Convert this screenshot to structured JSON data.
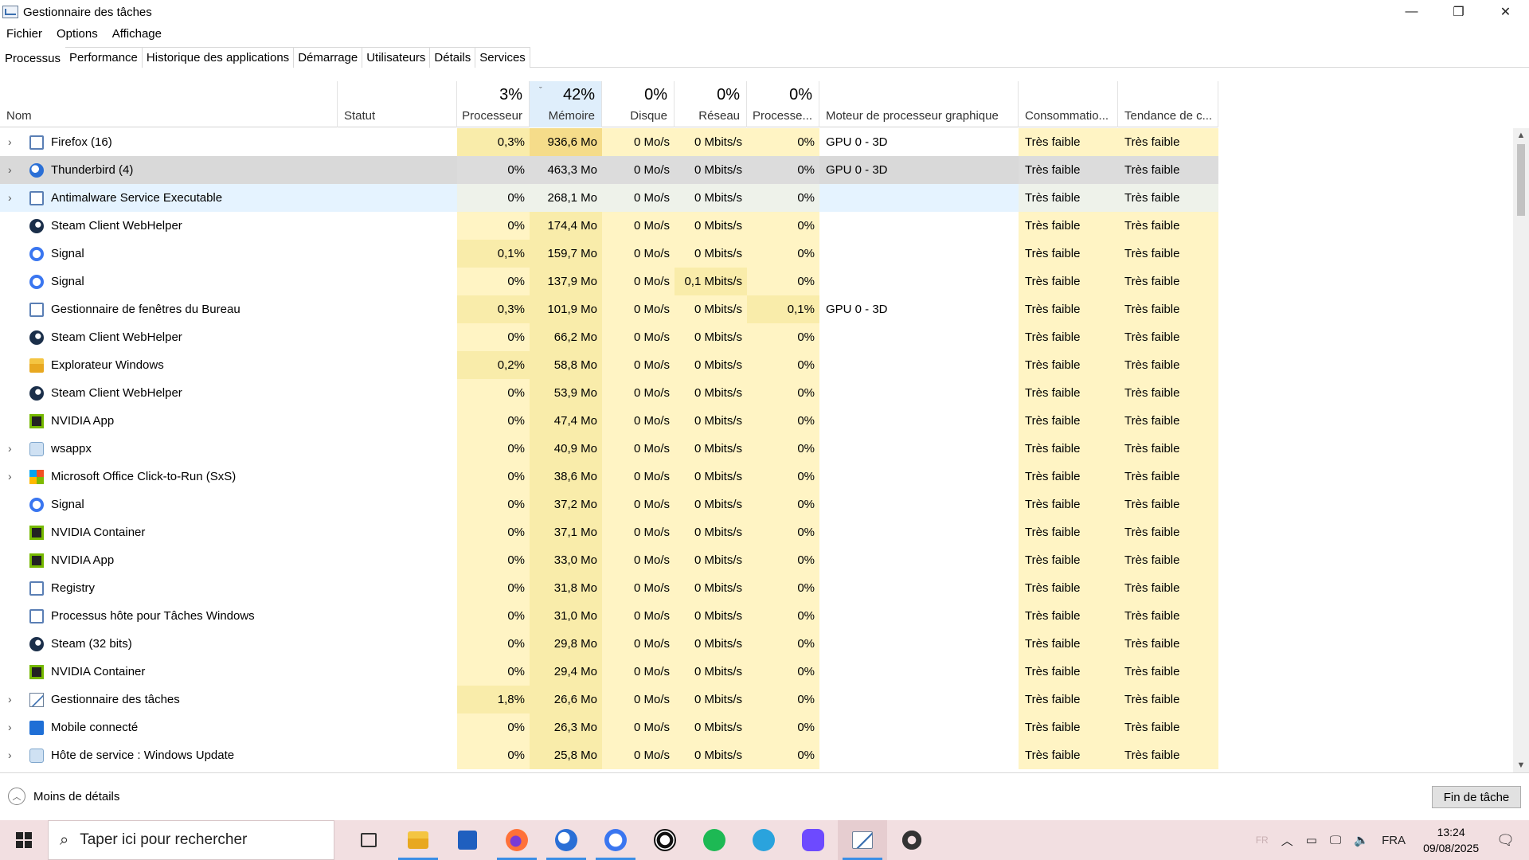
{
  "window": {
    "title": "Gestionnaire des tâches",
    "controls": {
      "minimize": "—",
      "maximize": "❐",
      "close": "✕"
    }
  },
  "menu": [
    "Fichier",
    "Options",
    "Affichage"
  ],
  "tabs": [
    "Processus",
    "Performance",
    "Historique des applications",
    "Démarrage",
    "Utilisateurs",
    "Détails",
    "Services"
  ],
  "columns": {
    "name": {
      "label": "Nom"
    },
    "status": {
      "label": "Statut"
    },
    "cpu": {
      "pct": "3%",
      "label": "Processeur"
    },
    "mem": {
      "pct": "42%",
      "label": "Mémoire",
      "sort": "ˇ"
    },
    "disk": {
      "pct": "0%",
      "label": "Disque"
    },
    "net": {
      "pct": "0%",
      "label": "Réseau"
    },
    "gpu": {
      "pct": "0%",
      "label": "Processe..."
    },
    "gpu_engine": {
      "label": "Moteur de processeur graphique"
    },
    "power": {
      "label": "Consommatio..."
    },
    "power_trend": {
      "label": "Tendance de c..."
    }
  },
  "processes": [
    {
      "name": "Firefox (16)",
      "expand": true,
      "icon": "generic-app-icon",
      "cpu": "0,3%",
      "mem": "936,6 Mo",
      "disk": "0 Mo/s",
      "net": "0 Mbits/s",
      "gpu": "0%",
      "engine": "GPU 0 - 3D",
      "power": "Très faible",
      "trend": "Très faible"
    },
    {
      "name": "Thunderbird (4)",
      "expand": true,
      "icon": "thunderbird-icon",
      "cpu": "0%",
      "mem": "463,3 Mo",
      "disk": "0 Mo/s",
      "net": "0 Mbits/s",
      "gpu": "0%",
      "engine": "GPU 0 - 3D",
      "power": "Très faible",
      "trend": "Très faible"
    },
    {
      "name": "Antimalware Service Executable",
      "expand": true,
      "icon": "generic-app-icon",
      "cpu": "0%",
      "mem": "268,1 Mo",
      "disk": "0 Mo/s",
      "net": "0 Mbits/s",
      "gpu": "0%",
      "engine": "",
      "power": "Très faible",
      "trend": "Très faible"
    },
    {
      "name": "Steam Client WebHelper",
      "expand": false,
      "icon": "steam-icon",
      "cpu": "0%",
      "mem": "174,4 Mo",
      "disk": "0 Mo/s",
      "net": "0 Mbits/s",
      "gpu": "0%",
      "engine": "",
      "power": "Très faible",
      "trend": "Très faible"
    },
    {
      "name": "Signal",
      "expand": false,
      "icon": "signal-icon",
      "cpu": "0,1%",
      "mem": "159,7 Mo",
      "disk": "0 Mo/s",
      "net": "0 Mbits/s",
      "gpu": "0%",
      "engine": "",
      "power": "Très faible",
      "trend": "Très faible"
    },
    {
      "name": "Signal",
      "expand": false,
      "icon": "signal-icon",
      "cpu": "0%",
      "mem": "137,9 Mo",
      "disk": "0 Mo/s",
      "net": "0,1 Mbits/s",
      "gpu": "0%",
      "engine": "",
      "power": "Très faible",
      "trend": "Très faible"
    },
    {
      "name": "Gestionnaire de fenêtres du Bureau",
      "expand": false,
      "icon": "generic-app-icon",
      "cpu": "0,3%",
      "mem": "101,9 Mo",
      "disk": "0 Mo/s",
      "net": "0 Mbits/s",
      "gpu": "0,1%",
      "engine": "GPU 0 - 3D",
      "power": "Très faible",
      "trend": "Très faible"
    },
    {
      "name": "Steam Client WebHelper",
      "expand": false,
      "icon": "steam-icon",
      "cpu": "0%",
      "mem": "66,2 Mo",
      "disk": "0 Mo/s",
      "net": "0 Mbits/s",
      "gpu": "0%",
      "engine": "",
      "power": "Très faible",
      "trend": "Très faible"
    },
    {
      "name": "Explorateur Windows",
      "expand": false,
      "icon": "folder-icon",
      "cpu": "0,2%",
      "mem": "58,8 Mo",
      "disk": "0 Mo/s",
      "net": "0 Mbits/s",
      "gpu": "0%",
      "engine": "",
      "power": "Très faible",
      "trend": "Très faible"
    },
    {
      "name": "Steam Client WebHelper",
      "expand": false,
      "icon": "steam-icon",
      "cpu": "0%",
      "mem": "53,9 Mo",
      "disk": "0 Mo/s",
      "net": "0 Mbits/s",
      "gpu": "0%",
      "engine": "",
      "power": "Très faible",
      "trend": "Très faible"
    },
    {
      "name": "NVIDIA App",
      "expand": false,
      "icon": "nvidia-icon",
      "cpu": "0%",
      "mem": "47,4 Mo",
      "disk": "0 Mo/s",
      "net": "0 Mbits/s",
      "gpu": "0%",
      "engine": "",
      "power": "Très faible",
      "trend": "Très faible"
    },
    {
      "name": "wsappx",
      "expand": true,
      "icon": "gear-app-icon",
      "cpu": "0%",
      "mem": "40,9 Mo",
      "disk": "0 Mo/s",
      "net": "0 Mbits/s",
      "gpu": "0%",
      "engine": "",
      "power": "Très faible",
      "trend": "Très faible"
    },
    {
      "name": "Microsoft Office Click-to-Run (SxS)",
      "expand": true,
      "icon": "office-icon",
      "cpu": "0%",
      "mem": "38,6 Mo",
      "disk": "0 Mo/s",
      "net": "0 Mbits/s",
      "gpu": "0%",
      "engine": "",
      "power": "Très faible",
      "trend": "Très faible"
    },
    {
      "name": "Signal",
      "expand": false,
      "icon": "signal-icon",
      "cpu": "0%",
      "mem": "37,2 Mo",
      "disk": "0 Mo/s",
      "net": "0 Mbits/s",
      "gpu": "0%",
      "engine": "",
      "power": "Très faible",
      "trend": "Très faible"
    },
    {
      "name": "NVIDIA Container",
      "expand": false,
      "icon": "nvidia-icon",
      "cpu": "0%",
      "mem": "37,1 Mo",
      "disk": "0 Mo/s",
      "net": "0 Mbits/s",
      "gpu": "0%",
      "engine": "",
      "power": "Très faible",
      "trend": "Très faible"
    },
    {
      "name": "NVIDIA App",
      "expand": false,
      "icon": "nvidia-icon",
      "cpu": "0%",
      "mem": "33,0 Mo",
      "disk": "0 Mo/s",
      "net": "0 Mbits/s",
      "gpu": "0%",
      "engine": "",
      "power": "Très faible",
      "trend": "Très faible"
    },
    {
      "name": "Registry",
      "expand": false,
      "icon": "generic-app-icon",
      "cpu": "0%",
      "mem": "31,8 Mo",
      "disk": "0 Mo/s",
      "net": "0 Mbits/s",
      "gpu": "0%",
      "engine": "",
      "power": "Très faible",
      "trend": "Très faible"
    },
    {
      "name": "Processus hôte pour Tâches Windows",
      "expand": false,
      "icon": "generic-app-icon",
      "cpu": "0%",
      "mem": "31,0 Mo",
      "disk": "0 Mo/s",
      "net": "0 Mbits/s",
      "gpu": "0%",
      "engine": "",
      "power": "Très faible",
      "trend": "Très faible"
    },
    {
      "name": "Steam (32 bits)",
      "expand": false,
      "icon": "steam-icon",
      "cpu": "0%",
      "mem": "29,8 Mo",
      "disk": "0 Mo/s",
      "net": "0 Mbits/s",
      "gpu": "0%",
      "engine": "",
      "power": "Très faible",
      "trend": "Très faible"
    },
    {
      "name": "NVIDIA Container",
      "expand": false,
      "icon": "nvidia-icon",
      "cpu": "0%",
      "mem": "29,4 Mo",
      "disk": "0 Mo/s",
      "net": "0 Mbits/s",
      "gpu": "0%",
      "engine": "",
      "power": "Très faible",
      "trend": "Très faible"
    },
    {
      "name": "Gestionnaire des tâches",
      "expand": true,
      "icon": "taskmanager-icon",
      "cpu": "1,8%",
      "mem": "26,6 Mo",
      "disk": "0 Mo/s",
      "net": "0 Mbits/s",
      "gpu": "0%",
      "engine": "",
      "power": "Très faible",
      "trend": "Très faible"
    },
    {
      "name": "Mobile connecté",
      "expand": true,
      "icon": "phone-link-icon",
      "cpu": "0%",
      "mem": "26,3 Mo",
      "disk": "0 Mo/s",
      "net": "0 Mbits/s",
      "gpu": "0%",
      "engine": "",
      "power": "Très faible",
      "trend": "Très faible"
    },
    {
      "name": "Hôte de service : Windows Update",
      "expand": true,
      "icon": "gear-app-icon",
      "cpu": "0%",
      "mem": "25,8 Mo",
      "disk": "0 Mo/s",
      "net": "0 Mbits/s",
      "gpu": "0%",
      "engine": "",
      "power": "Très faible",
      "trend": "Très faible"
    }
  ],
  "footer": {
    "less_details": "Moins de détails",
    "end_task": "Fin de tâche"
  },
  "taskbar": {
    "search_placeholder": "Taper ici pour rechercher",
    "apps": [
      "task-view-icon",
      "file-explorer-icon",
      "store-icon",
      "firefox-icon",
      "thunderbird-icon",
      "signal-icon",
      "whatsapp-icon",
      "spotify-icon",
      "telegram-icon",
      "proton-vpn-icon",
      "taskmanager-icon",
      "settings-icon"
    ],
    "tray": {
      "lang_hint": "FR",
      "lang": "FRA",
      "time": "13:24",
      "date": "09/08/2025"
    }
  },
  "colors": {
    "heat_low": "#fff4c4",
    "heat_mid": "#f9ecaa",
    "heat_high": "#f5dc8a",
    "selected": "#d9d9d9",
    "hover": "#e5f3ff",
    "taskbar": "#f2dfe1"
  }
}
